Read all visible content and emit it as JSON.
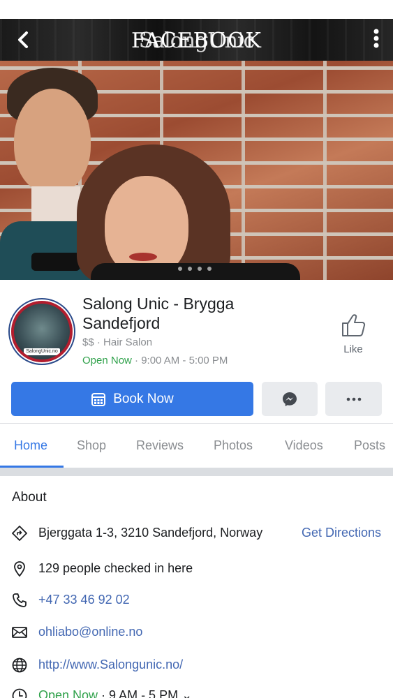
{
  "top_bar": {
    "title": "FACEBOOK",
    "overlay_text": "SalongUnic"
  },
  "page": {
    "name": "Salong Unic - Brygga Sandefjord",
    "meta": "$$ · Hair Salon",
    "open_status": "Open Now",
    "hours": " · 9:00 AM - 5:00 PM",
    "avatar_caption": "SalongUnic.no",
    "like_label": "Like"
  },
  "actions": {
    "book_label": "Book Now"
  },
  "tabs": [
    {
      "label": "Home",
      "active": true
    },
    {
      "label": "Shop"
    },
    {
      "label": "Reviews"
    },
    {
      "label": "Photos"
    },
    {
      "label": "Videos"
    },
    {
      "label": "Posts"
    }
  ],
  "about": {
    "title": "About",
    "address": "Bjerggata 1-3, 3210 Sandefjord, Norway",
    "directions": "Get Directions",
    "checkins": "129 people checked in here",
    "phone": "+47 33 46 92 02",
    "email": "ohliabo@online.no",
    "website": "http://www.Salongunic.no/",
    "hours_status": "Open Now",
    "hours_short": " · 9 AM - 5 PM"
  },
  "colors": {
    "accent": "#3578e5",
    "link": "#4267b2",
    "open": "#31a24c"
  }
}
